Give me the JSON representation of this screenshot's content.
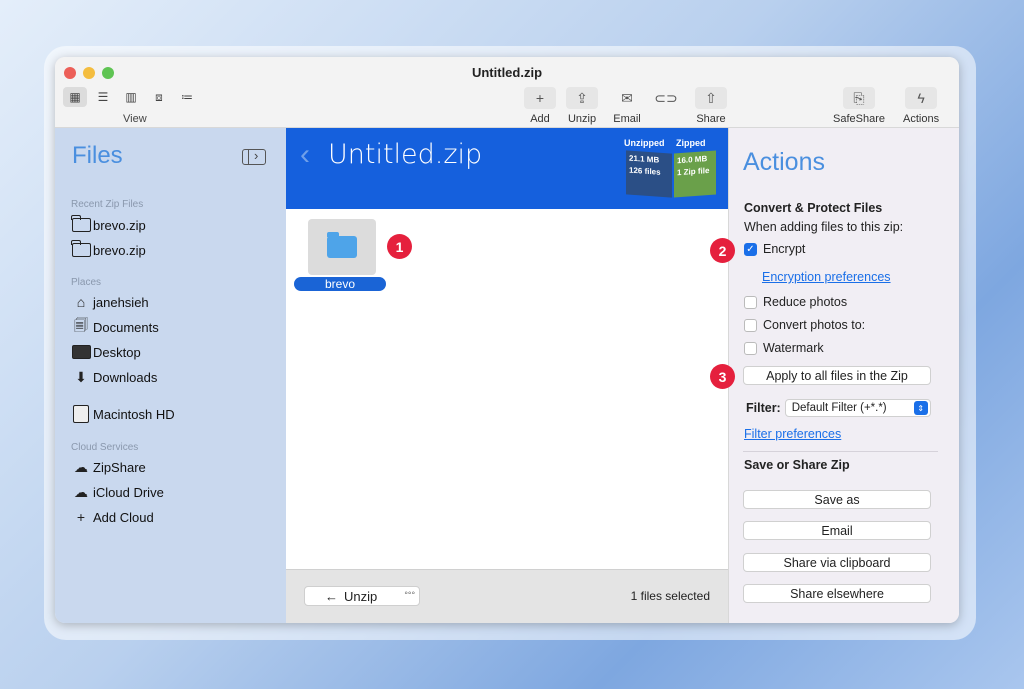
{
  "window": {
    "title": "Untitled.zip"
  },
  "toolbar": {
    "view_label": "View",
    "add_label": "Add",
    "unzip_label": "Unzip",
    "email_label": "Email",
    "share_label": "Share",
    "safeshare_label": "SafeShare",
    "actions_label": "Actions"
  },
  "sidebar": {
    "title": "Files",
    "recent_header": "Recent Zip Files",
    "recent": [
      "brevo.zip",
      "brevo.zip"
    ],
    "places_header": "Places",
    "places": [
      "janehsieh",
      "Documents",
      "Desktop",
      "Downloads",
      "Macintosh HD"
    ],
    "cloud_header": "Cloud Services",
    "cloud": [
      "ZipShare",
      "iCloud Drive",
      "Add Cloud"
    ]
  },
  "main": {
    "title": "Untitled.zip",
    "stats": {
      "unzipped_label": "Unzipped",
      "zipped_label": "Zipped",
      "unzipped_size": "21.1 MB",
      "unzipped_count": "126 files",
      "zipped_size": "16.0 MB",
      "zipped_count": "1 Zip file"
    },
    "file_name": "brevo",
    "unzip_button": "Unzip",
    "selection": "1 files selected"
  },
  "badges": [
    "1",
    "2",
    "3"
  ],
  "actions": {
    "title": "Actions",
    "convert_header": "Convert & Protect Files",
    "when_adding": "When adding files to this zip:",
    "encrypt": "Encrypt",
    "encrypt_checked": true,
    "encryption_prefs": "Encryption preferences",
    "reduce_photos": "Reduce photos",
    "convert_photos": "Convert photos to:",
    "watermark": "Watermark",
    "apply_button": "Apply to all files in the Zip",
    "filter_label": "Filter:",
    "filter_value": "Default Filter (+*.*)",
    "filter_prefs": "Filter preferences",
    "save_header": "Save or Share Zip",
    "save_as": "Save as",
    "email": "Email",
    "share_clipboard": "Share via clipboard",
    "share_elsewhere": "Share elsewhere"
  },
  "colors": {
    "accent": "#1560dd",
    "badge": "#e5203d",
    "sidebar": "#c9d8ee"
  }
}
